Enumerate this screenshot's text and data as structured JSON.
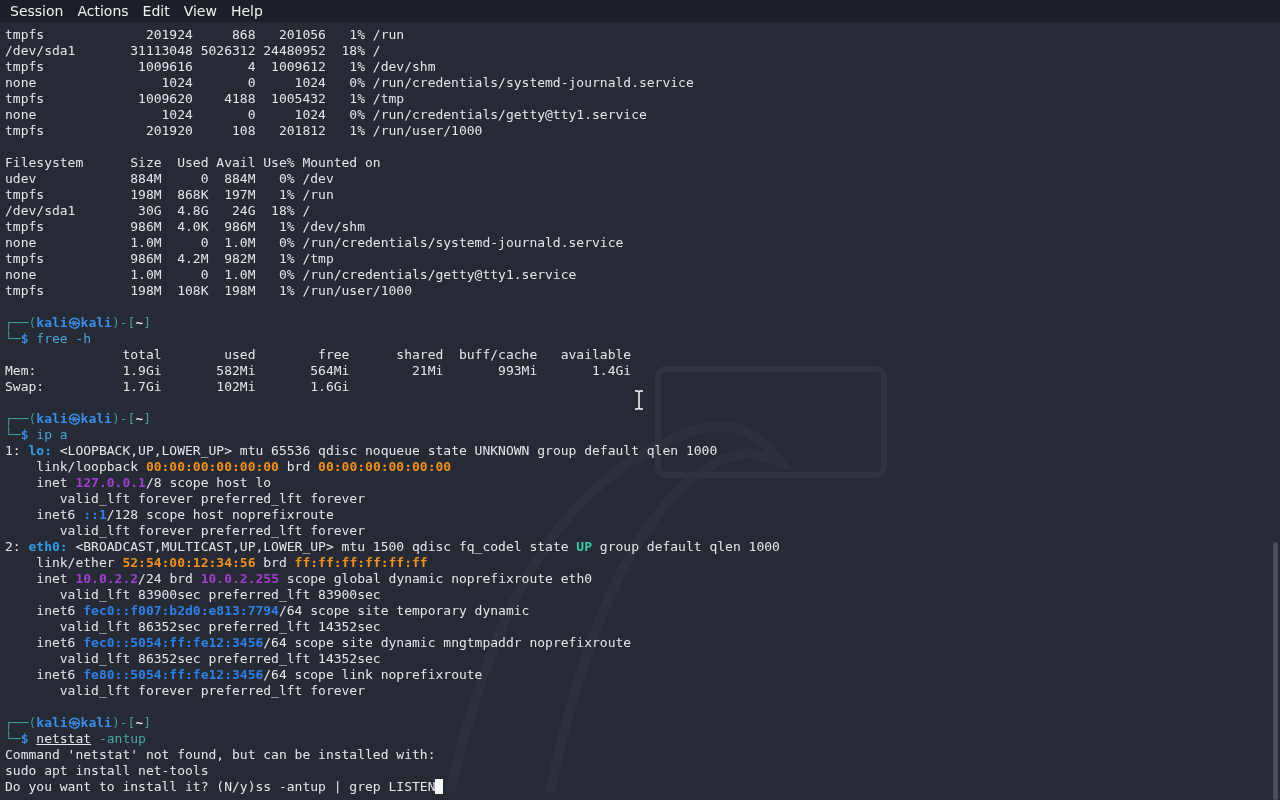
{
  "menu": [
    "Session",
    "Actions",
    "Edit",
    "View",
    "Help"
  ],
  "lines": [
    {
      "kind": "text",
      "segments": [
        {
          "kind": "text",
          "text": "tmpfs             201924     868   201056   1% /run"
        }
      ]
    },
    {
      "kind": "text",
      "segments": [
        {
          "kind": "text",
          "text": "/dev/sda1       31113048 5026312 24480952  18% /"
        }
      ]
    },
    {
      "kind": "text",
      "segments": [
        {
          "kind": "text",
          "text": "tmpfs            1009616       4  1009612   1% /dev/shm"
        }
      ]
    },
    {
      "kind": "text",
      "segments": [
        {
          "kind": "text",
          "text": "none                1024       0     1024   0% /run/credentials/systemd-journald.service"
        }
      ]
    },
    {
      "kind": "text",
      "segments": [
        {
          "kind": "text",
          "text": "tmpfs            1009620    4188  1005432   1% /tmp"
        }
      ]
    },
    {
      "kind": "text",
      "segments": [
        {
          "kind": "text",
          "text": "none                1024       0     1024   0% /run/credentials/getty@tty1.service"
        }
      ]
    },
    {
      "kind": "text",
      "segments": [
        {
          "kind": "text",
          "text": "tmpfs             201920     108   201812   1% /run/user/1000"
        }
      ]
    },
    {
      "kind": "blank"
    },
    {
      "kind": "text",
      "segments": [
        {
          "kind": "text",
          "text": "Filesystem      Size  Used Avail Use% Mounted on"
        }
      ]
    },
    {
      "kind": "text",
      "segments": [
        {
          "kind": "text",
          "text": "udev            884M     0  884M   0% /dev"
        }
      ]
    },
    {
      "kind": "text",
      "segments": [
        {
          "kind": "text",
          "text": "tmpfs           198M  868K  197M   1% /run"
        }
      ]
    },
    {
      "kind": "text",
      "segments": [
        {
          "kind": "text",
          "text": "/dev/sda1        30G  4.8G   24G  18% /"
        }
      ]
    },
    {
      "kind": "text",
      "segments": [
        {
          "kind": "text",
          "text": "tmpfs           986M  4.0K  986M   1% /dev/shm"
        }
      ]
    },
    {
      "kind": "text",
      "segments": [
        {
          "kind": "text",
          "text": "none            1.0M     0  1.0M   0% /run/credentials/systemd-journald.service"
        }
      ]
    },
    {
      "kind": "text",
      "segments": [
        {
          "kind": "text",
          "text": "tmpfs           986M  4.2M  982M   1% /tmp"
        }
      ]
    },
    {
      "kind": "text",
      "segments": [
        {
          "kind": "text",
          "text": "none            1.0M     0  1.0M   0% /run/credentials/getty@tty1.service"
        }
      ]
    },
    {
      "kind": "text",
      "segments": [
        {
          "kind": "text",
          "text": "tmpfs           198M  108K  198M   1% /run/user/1000"
        }
      ]
    },
    {
      "kind": "blank"
    },
    {
      "kind": "text",
      "segments": [
        {
          "kind": "frame",
          "text": "┌──("
        },
        {
          "kind": "user",
          "text": "kali㉿kali"
        },
        {
          "kind": "frame",
          "text": ")-["
        },
        {
          "kind": "dir",
          "text": "~"
        },
        {
          "kind": "frame",
          "text": "]"
        }
      ]
    },
    {
      "kind": "text",
      "segments": [
        {
          "kind": "frame",
          "text": "└─"
        },
        {
          "kind": "dollar",
          "text": "$ "
        },
        {
          "kind": "cmd",
          "text": "free -h"
        }
      ]
    },
    {
      "kind": "text",
      "segments": [
        {
          "kind": "text",
          "text": "               total        used        free      shared  buff/cache   available"
        }
      ]
    },
    {
      "kind": "text",
      "segments": [
        {
          "kind": "text",
          "text": "Mem:           1.9Gi       582Mi       564Mi        21Mi       993Mi       1.4Gi"
        }
      ]
    },
    {
      "kind": "text",
      "segments": [
        {
          "kind": "text",
          "text": "Swap:          1.7Gi       102Mi       1.6Gi"
        }
      ]
    },
    {
      "kind": "blank"
    },
    {
      "kind": "text",
      "segments": [
        {
          "kind": "frame",
          "text": "┌──("
        },
        {
          "kind": "user",
          "text": "kali㉿kali"
        },
        {
          "kind": "frame",
          "text": ")-["
        },
        {
          "kind": "dir",
          "text": "~"
        },
        {
          "kind": "frame",
          "text": "]"
        }
      ]
    },
    {
      "kind": "text",
      "segments": [
        {
          "kind": "frame",
          "text": "└─"
        },
        {
          "kind": "dollar",
          "text": "$ "
        },
        {
          "kind": "cmd",
          "text": "ip a"
        }
      ]
    },
    {
      "kind": "text",
      "segments": [
        {
          "kind": "text",
          "text": "1: "
        },
        {
          "kind": "iface",
          "text": "lo:"
        },
        {
          "kind": "text",
          "text": " <LOOPBACK,UP,LOWER_UP> mtu 65536 qdisc noqueue state UNKNOWN group default qlen 1000"
        }
      ]
    },
    {
      "kind": "text",
      "segments": [
        {
          "kind": "text",
          "text": "    link/loopback "
        },
        {
          "kind": "mac",
          "text": "00:00:00:00:00:00"
        },
        {
          "kind": "text",
          "text": " brd "
        },
        {
          "kind": "mac",
          "text": "00:00:00:00:00:00"
        }
      ]
    },
    {
      "kind": "text",
      "segments": [
        {
          "kind": "text",
          "text": "    inet "
        },
        {
          "kind": "ipv4",
          "text": "127.0.0.1"
        },
        {
          "kind": "text",
          "text": "/8 scope host lo"
        }
      ]
    },
    {
      "kind": "text",
      "segments": [
        {
          "kind": "text",
          "text": "       valid_lft forever preferred_lft forever"
        }
      ]
    },
    {
      "kind": "text",
      "segments": [
        {
          "kind": "text",
          "text": "    inet6 "
        },
        {
          "kind": "ipv6",
          "text": "::1"
        },
        {
          "kind": "text",
          "text": "/128 scope host noprefixroute"
        }
      ]
    },
    {
      "kind": "text",
      "segments": [
        {
          "kind": "text",
          "text": "       valid_lft forever preferred_lft forever"
        }
      ]
    },
    {
      "kind": "text",
      "segments": [
        {
          "kind": "text",
          "text": "2: "
        },
        {
          "kind": "iface",
          "text": "eth0:"
        },
        {
          "kind": "text",
          "text": " <BROADCAST,MULTICAST,UP,LOWER_UP> mtu 1500 qdisc fq_codel state "
        },
        {
          "kind": "up",
          "text": "UP"
        },
        {
          "kind": "text",
          "text": " group default qlen 1000"
        }
      ]
    },
    {
      "kind": "text",
      "segments": [
        {
          "kind": "text",
          "text": "    link/ether "
        },
        {
          "kind": "mac",
          "text": "52:54:00:12:34:56"
        },
        {
          "kind": "text",
          "text": " brd "
        },
        {
          "kind": "mac",
          "text": "ff:ff:ff:ff:ff:ff"
        }
      ]
    },
    {
      "kind": "text",
      "segments": [
        {
          "kind": "text",
          "text": "    inet "
        },
        {
          "kind": "ipv4",
          "text": "10.0.2.2"
        },
        {
          "kind": "text",
          "text": "/24 brd "
        },
        {
          "kind": "ipv4",
          "text": "10.0.2.255"
        },
        {
          "kind": "text",
          "text": " scope global dynamic noprefixroute eth0"
        }
      ]
    },
    {
      "kind": "text",
      "segments": [
        {
          "kind": "text",
          "text": "       valid_lft 83900sec preferred_lft 83900sec"
        }
      ]
    },
    {
      "kind": "text",
      "segments": [
        {
          "kind": "text",
          "text": "    inet6 "
        },
        {
          "kind": "ipv6",
          "text": "fec0::f007:b2d0:e813:7794"
        },
        {
          "kind": "text",
          "text": "/64 scope site temporary dynamic"
        }
      ]
    },
    {
      "kind": "text",
      "segments": [
        {
          "kind": "text",
          "text": "       valid_lft 86352sec preferred_lft 14352sec"
        }
      ]
    },
    {
      "kind": "text",
      "segments": [
        {
          "kind": "text",
          "text": "    inet6 "
        },
        {
          "kind": "ipv6",
          "text": "fec0::5054:ff:fe12:3456"
        },
        {
          "kind": "text",
          "text": "/64 scope site dynamic mngtmpaddr noprefixroute"
        }
      ]
    },
    {
      "kind": "text",
      "segments": [
        {
          "kind": "text",
          "text": "       valid_lft 86352sec preferred_lft 14352sec"
        }
      ]
    },
    {
      "kind": "text",
      "segments": [
        {
          "kind": "text",
          "text": "    inet6 "
        },
        {
          "kind": "ipv6",
          "text": "fe80::5054:ff:fe12:3456"
        },
        {
          "kind": "text",
          "text": "/64 scope link noprefixroute"
        }
      ]
    },
    {
      "kind": "text",
      "segments": [
        {
          "kind": "text",
          "text": "       valid_lft forever preferred_lft forever"
        }
      ]
    },
    {
      "kind": "blank"
    },
    {
      "kind": "text",
      "segments": [
        {
          "kind": "frame",
          "text": "┌──("
        },
        {
          "kind": "user",
          "text": "kali㉿kali"
        },
        {
          "kind": "frame",
          "text": ")-["
        },
        {
          "kind": "dir",
          "text": "~"
        },
        {
          "kind": "frame",
          "text": "]"
        }
      ]
    },
    {
      "kind": "text",
      "segments": [
        {
          "kind": "frame",
          "text": "└─"
        },
        {
          "kind": "dollar",
          "text": "$ "
        },
        {
          "kind": "badcmd",
          "text": "netstat"
        },
        {
          "kind": "arg",
          "text": " -antup"
        }
      ]
    },
    {
      "kind": "text",
      "segments": [
        {
          "kind": "text",
          "text": "Command 'netstat' not found, but can be installed with:"
        }
      ]
    },
    {
      "kind": "text",
      "segments": [
        {
          "kind": "text",
          "text": "sudo apt install net-tools"
        }
      ]
    },
    {
      "kind": "text",
      "cursor": true,
      "segments": [
        {
          "kind": "text",
          "text": "Do you want to install it? (N/y)ss -antup | grep LISTEN"
        }
      ]
    }
  ]
}
